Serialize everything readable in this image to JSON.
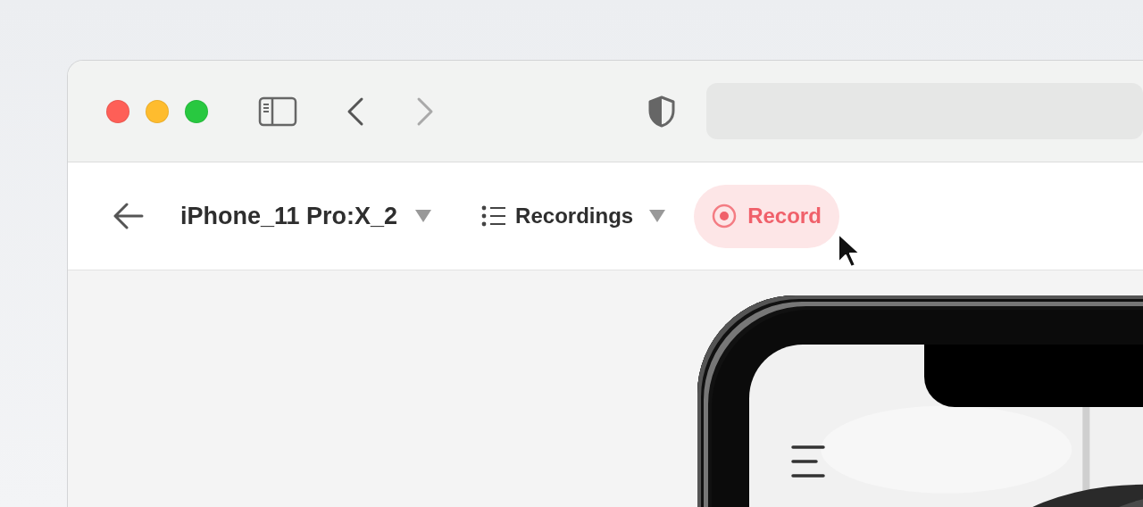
{
  "browser": {
    "back_disabled": false,
    "forward_disabled": true
  },
  "toolbar": {
    "device": {
      "label": "iPhone_11 Pro:X_2"
    },
    "view": {
      "label": "Recordings"
    },
    "record_button": {
      "label": "Record",
      "hovered": true
    }
  }
}
